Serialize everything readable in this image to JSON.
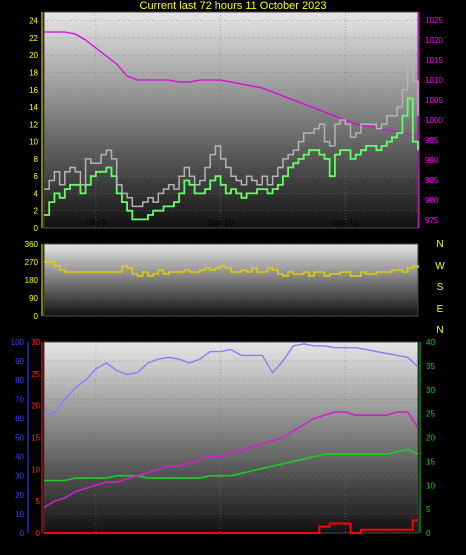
{
  "title": "Current last 72 hours 11 October 2023",
  "colors": {
    "temp": "#b4b4b4",
    "dew": "#66ff66",
    "pressure": "#e000e0",
    "winddir": "#e0d000",
    "solar": "#8080ff",
    "humidity": "#cc22cc",
    "hum2": "#22cc22",
    "rain": "#ff0000",
    "axis_yellow": "#ffff00",
    "axis_magenta": "#ff00ff",
    "axis_blue": "#4040ff",
    "axis_red": "#ff2020",
    "axis_green": "#00dd00"
  },
  "chart_data": [
    {
      "type": "line",
      "id": "temperature",
      "x_labels": [
        "Day 9",
        "Day 10",
        "Day 11"
      ],
      "x_label_positions": [
        10,
        34,
        58
      ],
      "xlim": [
        0,
        72
      ],
      "left_axis": {
        "ticks": [
          "0",
          "2",
          "4",
          "6",
          "8",
          "10",
          "12",
          "14",
          "16",
          "18",
          "20",
          "22",
          "24"
        ],
        "ylim": [
          0,
          25
        ]
      },
      "right_axis": {
        "ticks": [
          "975",
          "980",
          "985",
          "990",
          "995",
          "1000",
          "1005",
          "1010",
          "1015",
          "1020",
          "1025"
        ],
        "ylim": [
          973,
          1027
        ]
      },
      "series": [
        {
          "key": "temp",
          "axis": "left",
          "x": [
            0,
            1,
            2,
            3,
            4,
            5,
            6,
            7,
            8,
            9,
            10,
            11,
            12,
            13,
            14,
            15,
            16,
            17,
            18,
            19,
            20,
            21,
            22,
            23,
            24,
            25,
            26,
            27,
            28,
            29,
            30,
            31,
            32,
            33,
            34,
            35,
            36,
            37,
            38,
            39,
            40,
            41,
            42,
            43,
            44,
            45,
            46,
            47,
            48,
            49,
            50,
            51,
            52,
            53,
            54,
            55,
            56,
            57,
            58,
            59,
            60,
            61,
            62,
            63,
            64,
            65,
            66,
            67,
            68,
            69,
            70,
            71,
            72
          ],
          "values": [
            4.5,
            5.5,
            6.5,
            5,
            6.5,
            7,
            6.5,
            5,
            8,
            7.5,
            7.5,
            8.5,
            9,
            8,
            5,
            4,
            3.5,
            2.5,
            2.5,
            3,
            3.5,
            3,
            4,
            4.5,
            5,
            4.5,
            6,
            7,
            6,
            5,
            5.5,
            7,
            8.5,
            9.5,
            8,
            7,
            6,
            5.5,
            5,
            6,
            5.5,
            5,
            6,
            5,
            6,
            7,
            8,
            8.5,
            9,
            10,
            11,
            11,
            11.5,
            12,
            10,
            9.5,
            12,
            12.5,
            12,
            10.5,
            11,
            12,
            12,
            12,
            11.5,
            12,
            13,
            13,
            14,
            16,
            20.5,
            17,
            13
          ]
        },
        {
          "key": "dew",
          "axis": "left",
          "x": [
            0,
            1,
            2,
            3,
            4,
            5,
            6,
            7,
            8,
            9,
            10,
            11,
            12,
            13,
            14,
            15,
            16,
            17,
            18,
            19,
            20,
            21,
            22,
            23,
            24,
            25,
            26,
            27,
            28,
            29,
            30,
            31,
            32,
            33,
            34,
            35,
            36,
            37,
            38,
            39,
            40,
            41,
            42,
            43,
            44,
            45,
            46,
            47,
            48,
            49,
            50,
            51,
            52,
            53,
            54,
            55,
            56,
            57,
            58,
            59,
            60,
            61,
            62,
            63,
            64,
            65,
            66,
            67,
            68,
            69,
            70,
            71,
            72
          ],
          "values": [
            1.5,
            3,
            4,
            3.5,
            4.5,
            5,
            5,
            4,
            5,
            6,
            6.5,
            6.5,
            7,
            6,
            4,
            3,
            2,
            1,
            1,
            1,
            1.5,
            2,
            2,
            2.5,
            2.5,
            3,
            4,
            5.5,
            5,
            4,
            4,
            4.5,
            5.5,
            6,
            5,
            4,
            4.5,
            4,
            3.5,
            4,
            4,
            4.5,
            4.5,
            4,
            4.5,
            5,
            6,
            7,
            7.5,
            8,
            8.5,
            9,
            9,
            8.5,
            8,
            6,
            8.5,
            9,
            9,
            8,
            8.5,
            9,
            9.5,
            9.5,
            9,
            9.5,
            10,
            10.5,
            11,
            13,
            15,
            10,
            9
          ]
        },
        {
          "key": "pressure",
          "axis": "right",
          "x": [
            0,
            2,
            4,
            6,
            8,
            10,
            12,
            14,
            16,
            18,
            20,
            22,
            24,
            26,
            28,
            30,
            32,
            34,
            36,
            38,
            40,
            42,
            44,
            46,
            48,
            50,
            52,
            54,
            56,
            58,
            60,
            62,
            64,
            66,
            68,
            70,
            72
          ],
          "values": [
            1022,
            1022,
            1022,
            1021.5,
            1020,
            1018,
            1016,
            1014,
            1011,
            1010,
            1010,
            1010,
            1010,
            1009.5,
            1009.5,
            1010,
            1010,
            1010,
            1009.5,
            1009,
            1008.5,
            1008,
            1007,
            1006,
            1005,
            1004,
            1003,
            1002,
            1001,
            1000,
            999,
            998.5,
            998,
            997.5,
            997,
            996.5,
            996
          ]
        }
      ]
    },
    {
      "type": "line",
      "id": "wind-direction",
      "left_axis": {
        "ticks": [
          "0",
          "90",
          "180",
          "270",
          "360"
        ],
        "ylim": [
          0,
          360
        ]
      },
      "compass": [
        "N",
        "W",
        "S",
        "E",
        "N"
      ],
      "series": [
        {
          "key": "winddir",
          "axis": "left",
          "x": [
            0,
            1,
            2,
            3,
            4,
            5,
            6,
            7,
            8,
            9,
            10,
            11,
            12,
            13,
            14,
            15,
            16,
            17,
            18,
            19,
            20,
            21,
            22,
            23,
            24,
            25,
            26,
            27,
            28,
            29,
            30,
            31,
            32,
            33,
            34,
            35,
            36,
            37,
            38,
            39,
            40,
            41,
            42,
            43,
            44,
            45,
            46,
            47,
            48,
            49,
            50,
            51,
            52,
            53,
            54,
            55,
            56,
            57,
            58,
            59,
            60,
            61,
            62,
            63,
            64,
            65,
            66,
            67,
            68,
            69,
            70,
            71,
            72
          ],
          "values": [
            270,
            270,
            250,
            230,
            220,
            220,
            220,
            220,
            220,
            220,
            220,
            220,
            220,
            220,
            220,
            250,
            240,
            210,
            200,
            220,
            200,
            210,
            230,
            210,
            220,
            220,
            220,
            230,
            220,
            220,
            230,
            240,
            230,
            240,
            250,
            240,
            220,
            220,
            230,
            220,
            240,
            220,
            220,
            240,
            230,
            210,
            200,
            220,
            210,
            210,
            220,
            200,
            220,
            220,
            200,
            210,
            210,
            220,
            220,
            200,
            200,
            220,
            210,
            210,
            220,
            220,
            220,
            230,
            230,
            220,
            240,
            250,
            240
          ]
        }
      ]
    },
    {
      "type": "line",
      "id": "solar-humidity-rain",
      "x_labels": [
        "Day 9",
        "Day 10",
        "Day 11"
      ],
      "x_label_positions": [
        10,
        34,
        58
      ],
      "xlim": [
        0,
        72
      ],
      "axis_blue": {
        "ticks": [
          "0",
          "10",
          "20",
          "30",
          "40",
          "50",
          "60",
          "70",
          "80",
          "90",
          "100"
        ],
        "ylim": [
          0,
          100
        ]
      },
      "axis_red": {
        "ticks": [
          "0",
          "5",
          "10",
          "15",
          "20",
          "25",
          "30"
        ],
        "ylim": [
          0,
          30
        ]
      },
      "axis_green": {
        "ticks": [
          "0",
          "5",
          "10",
          "15",
          "20",
          "25",
          "30",
          "35",
          "40"
        ],
        "ylim": [
          0,
          40
        ]
      },
      "series": [
        {
          "key": "solar",
          "axis": "blue",
          "x": [
            0,
            2,
            4,
            6,
            8,
            10,
            12,
            14,
            16,
            18,
            20,
            22,
            24,
            26,
            28,
            30,
            32,
            34,
            36,
            38,
            40,
            42,
            44,
            46,
            48,
            50,
            52,
            54,
            56,
            58,
            60,
            62,
            64,
            66,
            68,
            70,
            72
          ],
          "values": [
            62,
            63,
            70,
            76,
            80,
            86,
            89,
            85,
            83,
            84,
            89,
            91,
            92,
            91,
            89,
            91,
            95,
            95,
            96,
            93,
            93,
            93,
            84,
            90,
            98,
            99,
            98,
            98,
            97,
            97,
            97,
            96,
            95,
            94,
            93,
            92,
            87
          ]
        },
        {
          "key": "hum2",
          "axis": "green",
          "x": [
            0,
            2,
            4,
            6,
            8,
            10,
            12,
            14,
            16,
            18,
            20,
            22,
            24,
            26,
            28,
            30,
            32,
            34,
            36,
            38,
            40,
            42,
            44,
            46,
            48,
            50,
            52,
            54,
            56,
            58,
            60,
            62,
            64,
            66,
            68,
            70,
            72
          ],
          "values": [
            11,
            11,
            11,
            11.5,
            11.5,
            11.5,
            11.5,
            12,
            12,
            12,
            11.5,
            11.5,
            11.5,
            11.5,
            11.5,
            11.5,
            12,
            12,
            12,
            12.5,
            13,
            13.5,
            14,
            14.5,
            15,
            15.5,
            16,
            16.5,
            16.5,
            16.5,
            16.5,
            16.5,
            16.5,
            16.5,
            17,
            17.5,
            16.5
          ]
        },
        {
          "key": "humidity",
          "axis": "red",
          "x": [
            0,
            2,
            4,
            6,
            8,
            10,
            12,
            14,
            16,
            18,
            20,
            22,
            24,
            26,
            28,
            30,
            32,
            34,
            36,
            38,
            40,
            42,
            44,
            46,
            48,
            50,
            52,
            54,
            56,
            58,
            60,
            62,
            64,
            66,
            68,
            70,
            72
          ],
          "values": [
            4,
            5,
            5.5,
            6.5,
            7,
            7.5,
            8,
            8,
            8.5,
            9,
            9.5,
            10,
            10.5,
            10.5,
            11,
            11.5,
            12,
            12,
            12.5,
            13,
            13.5,
            14,
            14.5,
            15,
            16,
            17,
            18,
            18.5,
            19,
            19,
            18.5,
            18.5,
            18.5,
            18.5,
            19,
            19,
            16.5
          ]
        },
        {
          "key": "rain",
          "axis": "red",
          "x": [
            0,
            52,
            53,
            55,
            58,
            59,
            60,
            61,
            62,
            63,
            64,
            65,
            66,
            67,
            68,
            69,
            70,
            71,
            72
          ],
          "values": [
            0,
            0,
            1,
            1.5,
            1.5,
            0,
            0,
            0.5,
            0.5,
            0.5,
            0.5,
            0.5,
            0.5,
            0.5,
            0.5,
            0.5,
            0.5,
            2,
            2
          ]
        }
      ]
    }
  ]
}
